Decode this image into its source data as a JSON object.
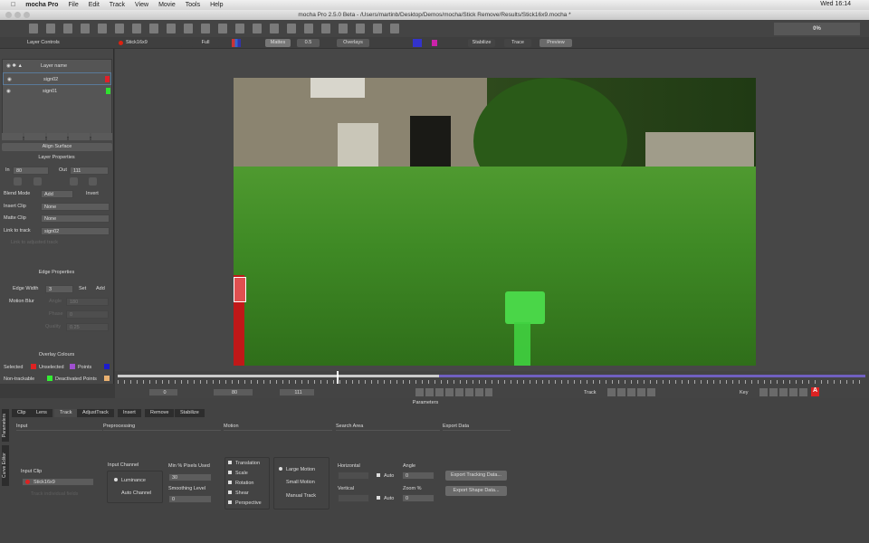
{
  "menubar": {
    "app": "mocha Pro",
    "items": [
      "File",
      "Edit",
      "Track",
      "View",
      "Movie",
      "Tools",
      "Help"
    ],
    "clock": "Wed 16:14"
  },
  "window": {
    "title": "mocha Pro 2.5.0 Beta - /Users/martinb/Desktop/Demos/mocha/Stick Remove/Results/Stick16x9.mocha *"
  },
  "toolbar": {
    "progress": "0%"
  },
  "toolbar2": {
    "clip": "Stick16x9",
    "resolution": "Full",
    "view_mode": "Mattes",
    "zoom": "0.5",
    "overlays": "Overlays",
    "stabilize": "Stabilize",
    "trace": "Trace",
    "preview": "Preview"
  },
  "layer_controls": {
    "title": "Layer Controls",
    "header": "Layer name",
    "layers": [
      {
        "name": "sign02",
        "color": "#e0202a"
      },
      {
        "name": "sign01",
        "color": "#30e030"
      }
    ],
    "align_surface": "Align Surface"
  },
  "layer_properties": {
    "title": "Layer Properties",
    "in_label": "In",
    "in_value": "80",
    "out_label": "Out",
    "out_value": "111",
    "blend_mode_label": "Blend Mode",
    "blend_mode": "Add",
    "invert": "Invert",
    "insert_clip_label": "Insert Clip",
    "insert_clip": "None",
    "matte_clip_label": "Matte Clip",
    "matte_clip": "None",
    "link_label": "Link to track",
    "link_value": "sign02",
    "adjusted_track": "Link to adjusted track"
  },
  "edge_properties": {
    "title": "Edge Properties",
    "edge_width_label": "Edge Width",
    "edge_width": "3",
    "set": "Set",
    "add": "Add",
    "motion_blur": "Motion Blur",
    "angle_label": "Angle",
    "angle": "180",
    "phase_label": "Phase",
    "phase": "0",
    "quality_label": "Quality",
    "quality": "0.25"
  },
  "overlay_colours": {
    "title": "Overlay Colours",
    "selected": "Selected",
    "unselected": "Unselected",
    "points": "Points",
    "non_trackable": "Non-trackable",
    "deactivated": "Deactivated Points"
  },
  "timeline": {
    "in": "0",
    "current": "80",
    "out": "111",
    "track_label": "Track",
    "key_label": "Key",
    "parameters": "Parameters",
    "progress": 0.43
  },
  "bottom": {
    "side_tabs": [
      "Parameters",
      "Curve Editor"
    ],
    "tabs": [
      "Clip",
      "Lens",
      "Track",
      "AdjustTrack",
      "Insert",
      "Remove",
      "Stabilize"
    ],
    "active_tab": "Track",
    "sections": [
      "Input",
      "Preprocessing",
      "Motion",
      "Search Area",
      "Export Data"
    ],
    "input_clip_label": "Input Clip",
    "input_clip": "Stick16x9",
    "track_individual": "Track individual fields",
    "input_channel_label": "Input Channel",
    "luminance": "Luminance",
    "auto_channel": "Auto Channel",
    "min_pixels_label": "Min % Pixels Used",
    "min_pixels": "30",
    "smoothing_label": "Smoothing Level",
    "smoothing": "0",
    "motion": [
      "Translation",
      "Scale",
      "Rotation",
      "Shear",
      "Perspective"
    ],
    "motion_type": [
      "Large Motion",
      "Small Motion",
      "Manual Track"
    ],
    "horizontal_label": "Horizontal",
    "vertical_label": "Vertical",
    "auto": "Auto",
    "angle_label": "Angle",
    "angle": "0",
    "zoom_label": "Zoom %",
    "zoom": "0",
    "export_tracking": "Export Tracking Data...",
    "export_shape": "Export Shape Data..."
  }
}
